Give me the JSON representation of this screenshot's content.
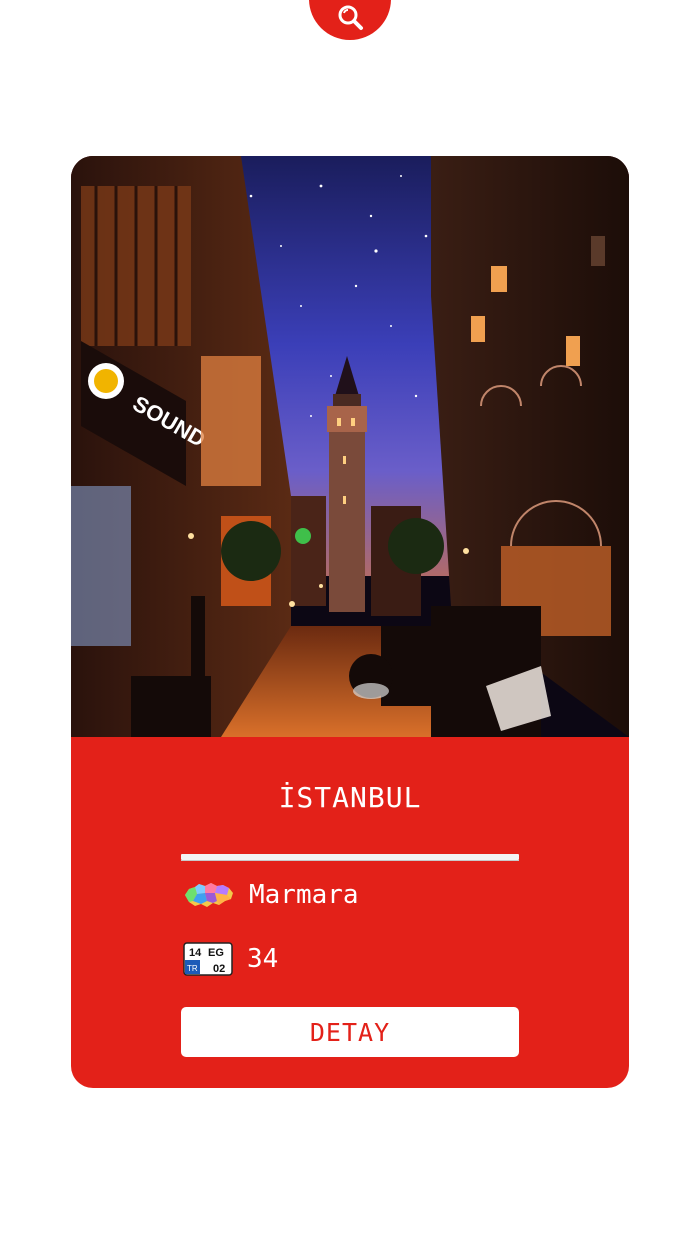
{
  "search": {
    "icon": "search-icon"
  },
  "city": {
    "name": "İSTANBUL",
    "photo": "galata-tower-night-street-photo",
    "region": "Marmara",
    "region_icon": "turkey-regions-map-icon",
    "plate_code": "34",
    "plate_icon": "license-plate-icon",
    "plate_icon_text": {
      "top_left": "14",
      "top_right": "EG",
      "country": "TR",
      "bottom_right": "02"
    }
  },
  "actions": {
    "detail_label": "DETAY"
  },
  "colors": {
    "accent": "#e32119",
    "background": "#ffffff",
    "text_on_accent": "#ffffff"
  }
}
